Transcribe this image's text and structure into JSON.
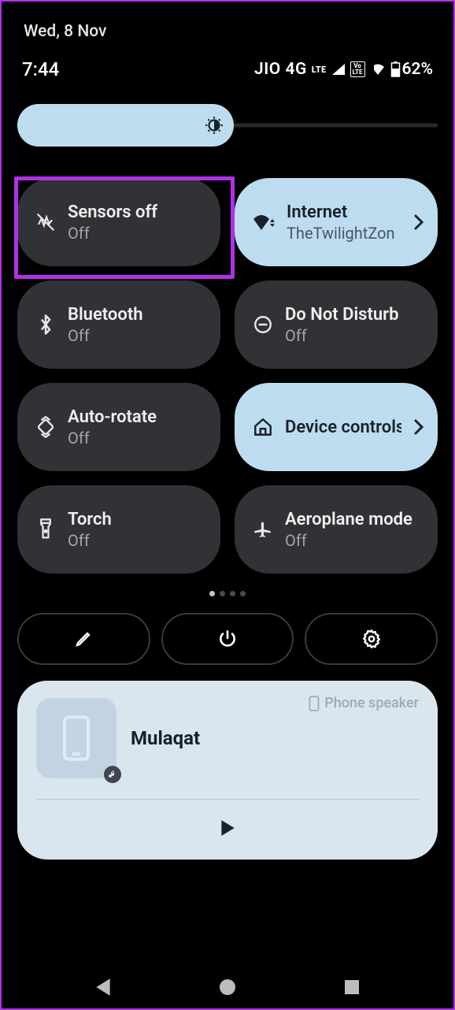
{
  "date": "Wed, 8 Nov",
  "time": "7:44",
  "status": {
    "carrier": "JIO 4G",
    "lte": "LTE",
    "volte_top": "Vo",
    "volte_bot": "LTE",
    "battery": "62%"
  },
  "tiles": [
    {
      "title": "Sensors off",
      "sub": "Off",
      "active": false,
      "chev": false,
      "icon": "sensors",
      "highlighted": true
    },
    {
      "title": "Internet",
      "sub": "TheTwilightZon",
      "active": true,
      "chev": true,
      "icon": "wifi"
    },
    {
      "title": "Bluetooth",
      "sub": "Off",
      "active": false,
      "chev": false,
      "icon": "bluetooth"
    },
    {
      "title": "Do Not Disturb",
      "sub": "Off",
      "active": false,
      "chev": false,
      "icon": "dnd"
    },
    {
      "title": "Auto-rotate",
      "sub": "Off",
      "active": false,
      "chev": false,
      "icon": "rotate"
    },
    {
      "title": "Device controls",
      "sub": "",
      "active": true,
      "chev": true,
      "icon": "home"
    },
    {
      "title": "Torch",
      "sub": "Off",
      "active": false,
      "chev": false,
      "icon": "torch"
    },
    {
      "title": "Aeroplane mode",
      "sub": "Off",
      "active": false,
      "chev": false,
      "icon": "plane"
    }
  ],
  "pager": {
    "count": 4,
    "active": 0
  },
  "media": {
    "title": "Mulaqat",
    "output": "Phone speaker"
  }
}
